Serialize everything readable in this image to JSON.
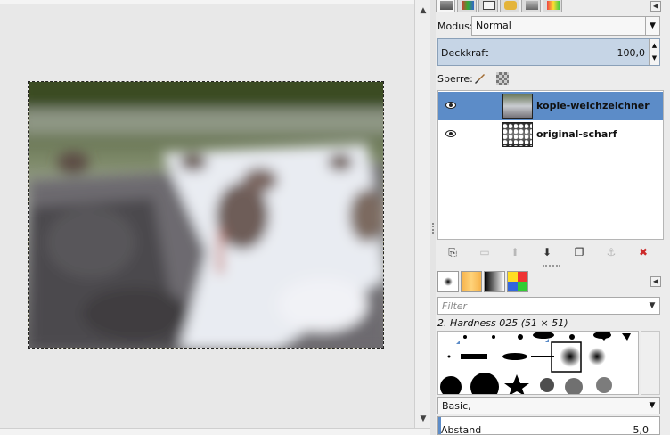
{
  "layers_panel": {
    "mode_label": "Modus:",
    "mode_value": "Normal",
    "opacity_label": "Deckkraft",
    "opacity_value": "100,0",
    "lock_label": "Sperre:",
    "layers": [
      {
        "name": "kopie-weichzeichner",
        "selected": true,
        "visible": true
      },
      {
        "name": "original-scharf",
        "selected": false,
        "visible": true
      }
    ]
  },
  "brushes_panel": {
    "filter_placeholder": "Filter",
    "selected_brush": "2. Hardness 025 (51 × 51)",
    "preset_value": "Basic,",
    "spacing_label": "Abstand",
    "spacing_value": "5,0"
  },
  "icons": {
    "eye": "eye-icon",
    "brush_lock": "paintbrush-icon",
    "alpha_lock": "checkerboard-icon",
    "new_layer": "new-layer-icon",
    "new_group": "folder-icon",
    "raise": "arrow-up-icon",
    "lower": "arrow-down-icon",
    "duplicate": "duplicate-icon",
    "anchor": "anchor-icon",
    "delete": "delete-x-icon"
  },
  "colors": {
    "selection": "#5c8cc8",
    "opacity_bg": "#c6d5e6",
    "delete_red": "#cc2a2a"
  }
}
